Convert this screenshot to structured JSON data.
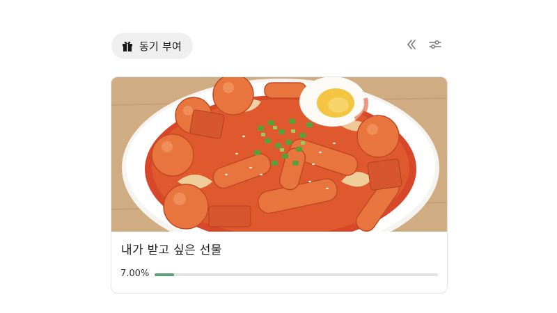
{
  "header": {
    "chip_label": "동기 부여",
    "chip_icon": "gift-icon",
    "collapse_icon": "double-chevron-left-icon",
    "filter_icon": "sliders-icon"
  },
  "card": {
    "title": "내가 받고 싶은 선물",
    "image_description_icon": "tteokbokki-photo",
    "progress_label": "7.00%",
    "progress_value": 0.07,
    "progress_color": "#5a9e74"
  }
}
